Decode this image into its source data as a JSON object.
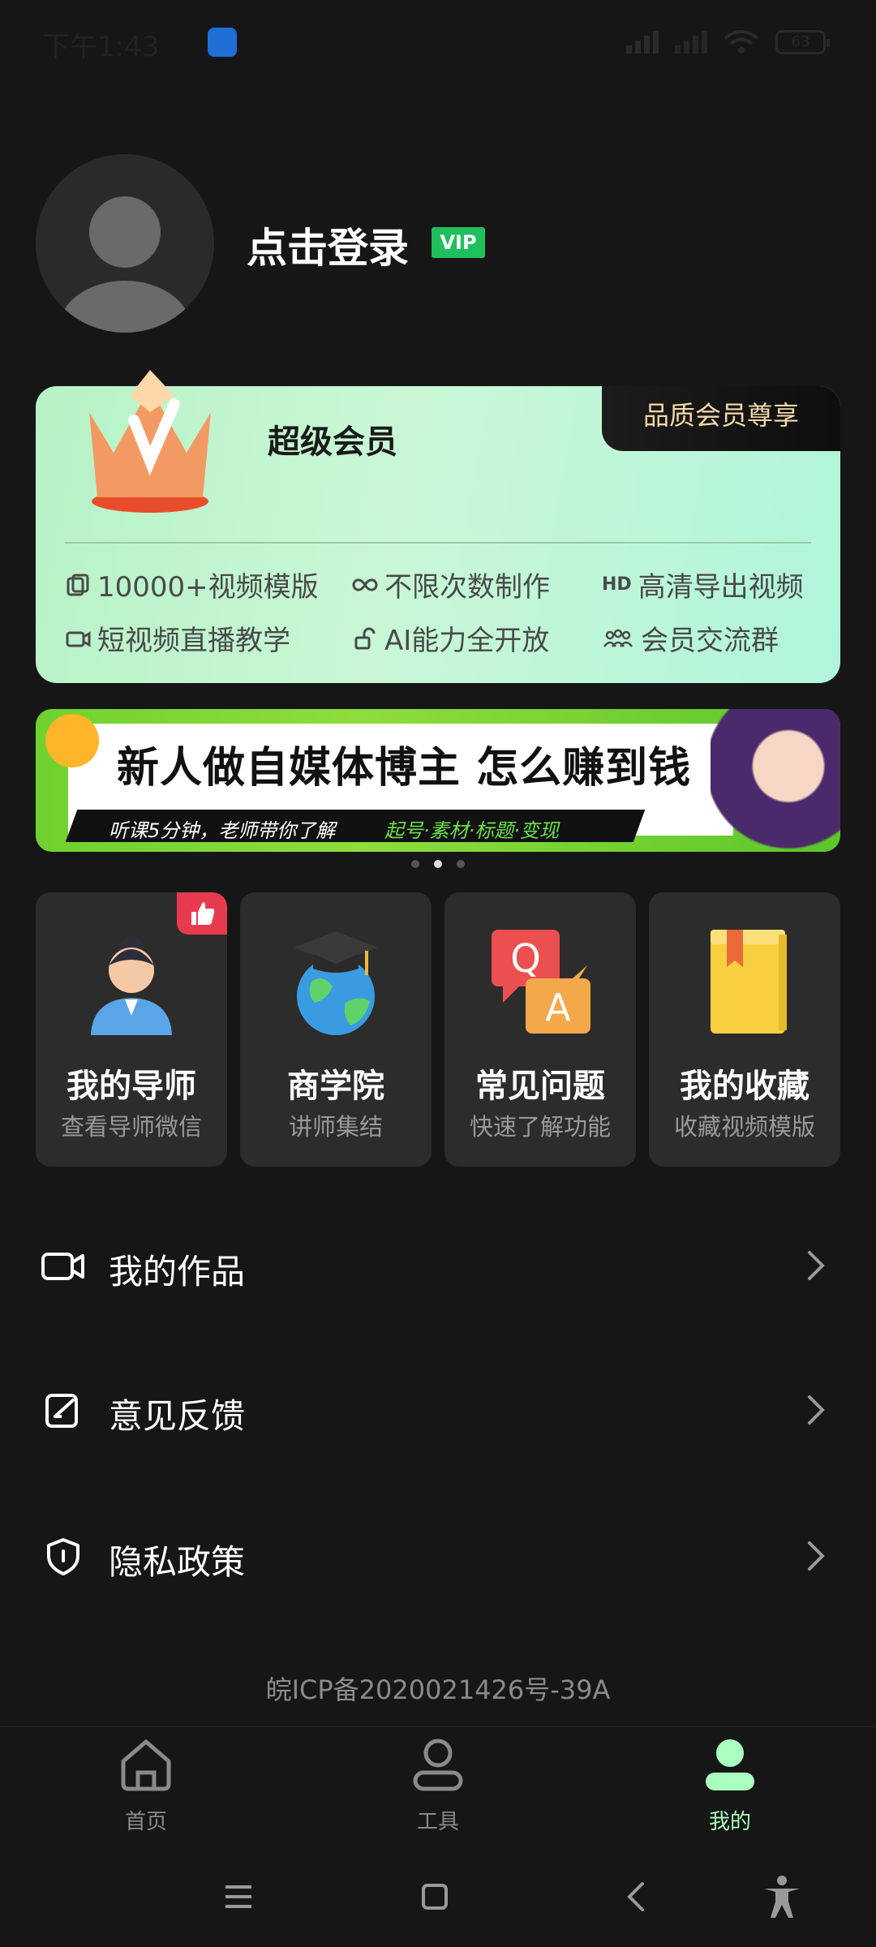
{
  "status_bar": {
    "time": "下午1:43",
    "battery": "63"
  },
  "profile": {
    "login_text": "点击登录",
    "vip_badge": "VIP"
  },
  "member_card": {
    "title": "超级会员",
    "badge": "品质会员尊享",
    "features": [
      {
        "icon": "template-icon",
        "label": "10000+视频模版"
      },
      {
        "icon": "infinity-icon",
        "label": "不限次数制作"
      },
      {
        "icon": "hd-icon",
        "label": "高清导出视频"
      },
      {
        "icon": "video-icon",
        "label": "短视频直播教学"
      },
      {
        "icon": "unlock-icon",
        "label": "AI能力全开放"
      },
      {
        "icon": "group-icon",
        "label": "会员交流群"
      }
    ],
    "hd_tag": "HD"
  },
  "banner": {
    "headline": "新人做自媒体博主 怎么赚到钱",
    "sub_left": "听课5分钟，老师带你了解",
    "sub_right": "起号·素材·标题·变现",
    "active_dot": 1
  },
  "tiles": [
    {
      "title": "我的导师",
      "subtitle": "查看导师微信",
      "icon": "mentor-icon"
    },
    {
      "title": "商学院",
      "subtitle": "讲师集结",
      "icon": "graduation-globe-icon"
    },
    {
      "title": "常见问题",
      "subtitle": "快速了解功能",
      "icon": "qa-icon"
    },
    {
      "title": "我的收藏",
      "subtitle": "收藏视频模版",
      "icon": "book-icon"
    }
  ],
  "menu": [
    {
      "label": "我的作品",
      "icon": "video-camera-icon"
    },
    {
      "label": "意见反馈",
      "icon": "feedback-edit-icon"
    },
    {
      "label": "隐私政策",
      "icon": "shield-icon"
    }
  ],
  "icp": "皖ICP备2020021426号-39A",
  "tabbar": [
    {
      "label": "首页",
      "icon": "home-icon"
    },
    {
      "label": "工具",
      "icon": "tools-icon"
    },
    {
      "label": "我的",
      "icon": "profile-icon"
    }
  ],
  "colors": {
    "accent": "#a9ffbe",
    "vip_green": "#1fbf5e",
    "background": "#161616"
  }
}
